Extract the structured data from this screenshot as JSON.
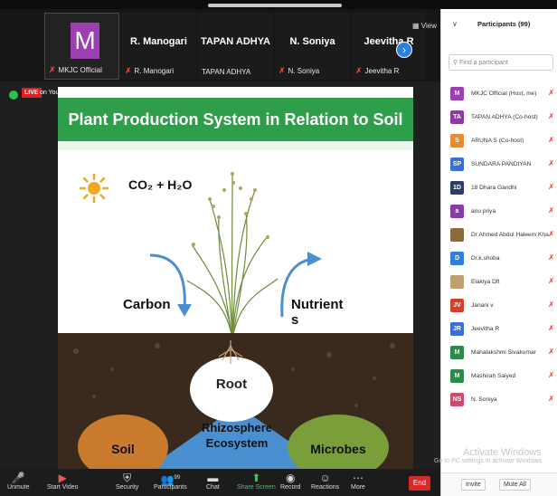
{
  "gallery": {
    "thumbs": [
      {
        "big": "M",
        "label": "MKJC Official"
      },
      {
        "big": "R. Manogari",
        "label": "R. Manogari"
      },
      {
        "big": "TAPAN ADHYA",
        "label": "TAPAN ADHYA"
      },
      {
        "big": "N. Soniya",
        "label": "N. Soniya"
      },
      {
        "big": "Jeevitha R",
        "label": "Jeevitha R"
      }
    ],
    "view_label": "View"
  },
  "live": {
    "badge": "LIVE",
    "on_youtube": "on YouTube ▾"
  },
  "slide": {
    "title": "Plant Production System in Relation to Soil",
    "co2": "CO₂ + H₂O",
    "carbon": "Carbon",
    "nutrient": "Nutrient",
    "nutrient_cut": "s",
    "root": "Root",
    "rhizosphere": "Rhizosphere Ecosystem",
    "soil": "Soil",
    "microbes": "Microbes"
  },
  "toolbar": {
    "unmute": "Unmute",
    "start_video": "Start Video",
    "security": "Security",
    "participants": "Participants",
    "participants_count": "99",
    "chat": "Chat",
    "share_screen": "Share Screen",
    "record": "Record",
    "reactions": "Reactions",
    "more": "More",
    "end": "End"
  },
  "panel": {
    "title": "Participants (99)",
    "search_placeholder": "Find a participant",
    "participants": [
      {
        "initials": "M",
        "name": "MKJC Official (Host, me)",
        "color": "#9b3fb3"
      },
      {
        "initials": "TA",
        "name": "TAPAN ADHYA (Co-host)",
        "color": "#8e3aa0"
      },
      {
        "initials": "S",
        "name": "ARUNA S (Co-host)",
        "color": "#e88b2e"
      },
      {
        "initials": "SP",
        "name": "SUNDARA PANDIYAN",
        "color": "#3a6fd8"
      },
      {
        "initials": "1D",
        "name": "18 Dhara Gandhi",
        "color": "#2a3e6a"
      },
      {
        "initials": "a",
        "name": "anu priya",
        "color": "#8a3ab0"
      },
      {
        "initials": "",
        "name": "Dr Ahmed Abdul Haleem Khan",
        "color": "#8a6a3a"
      },
      {
        "initials": "D",
        "name": "Dr.k.shoba",
        "color": "#2f7fe0"
      },
      {
        "initials": "",
        "name": "Elakiya Dft",
        "color": "#c0a070"
      },
      {
        "initials": "JV",
        "name": "Janani  v",
        "color": "#d0402a"
      },
      {
        "initials": "JR",
        "name": "Jeevitha R",
        "color": "#3a6fd8"
      },
      {
        "initials": "M",
        "name": "Mahalakshmi Sivakumar",
        "color": "#2e8a48"
      },
      {
        "initials": "M",
        "name": "Mashirah Saiyed",
        "color": "#2e8a48"
      },
      {
        "initials": "NS",
        "name": "N. Soniya",
        "color": "#d04a6a"
      }
    ],
    "invite": "Invite",
    "mute_all": "Mute All"
  },
  "windows_notice": {
    "title": "Activate Windows",
    "subtitle": "Go to PC settings to activate Windows."
  }
}
